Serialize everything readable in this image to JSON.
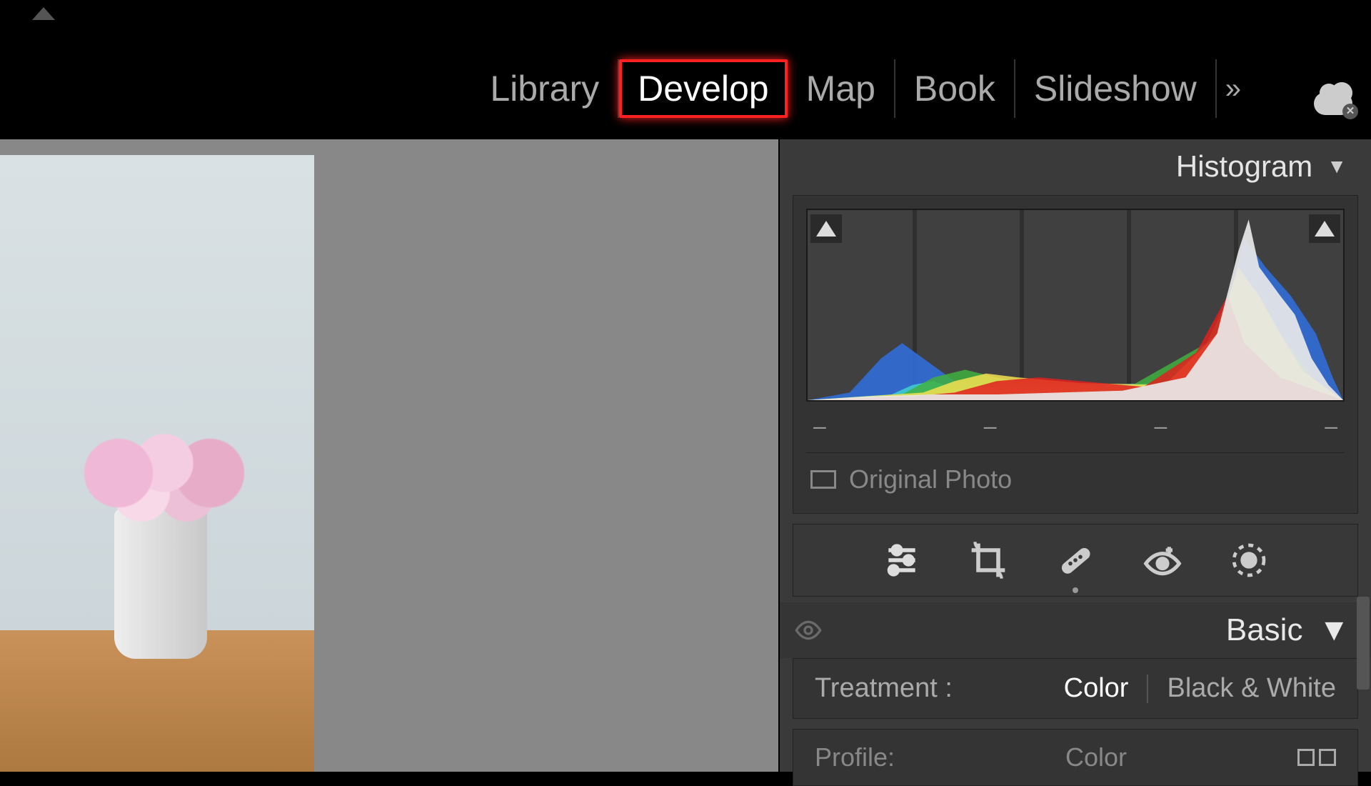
{
  "modules": {
    "items": [
      "Library",
      "Develop",
      "Map",
      "Book",
      "Slideshow"
    ],
    "active_index": 1
  },
  "panels": {
    "histogram": {
      "title": "Histogram"
    },
    "basic": {
      "title": "Basic"
    }
  },
  "histogram": {
    "info_placeholders": [
      "–",
      "–",
      "–",
      "–"
    ],
    "original_label": "Original Photo",
    "clip_shadow": "off",
    "clip_highlight": "off"
  },
  "tools": {
    "edit": "Edit",
    "crop": "Crop",
    "healing": "Healing",
    "redeye": "Red Eye",
    "masking": "Masking"
  },
  "basic": {
    "treatment_label": "Treatment :",
    "treatment_options": [
      "Color",
      "Black & White"
    ],
    "selected_treatment": "Color",
    "profile_label": "Profile:",
    "profile_value": "Color"
  },
  "chart_data": {
    "type": "area",
    "title": "Histogram",
    "xlabel": "",
    "ylabel": "",
    "xlim": [
      0,
      255
    ],
    "ylim": [
      0,
      100
    ],
    "series": [
      {
        "name": "luminance",
        "color": "#e8e8e8",
        "values": [
          [
            0,
            0
          ],
          [
            30,
            2
          ],
          [
            60,
            3
          ],
          [
            90,
            3
          ],
          [
            120,
            4
          ],
          [
            150,
            5
          ],
          [
            180,
            12
          ],
          [
            195,
            35
          ],
          [
            205,
            78
          ],
          [
            210,
            95
          ],
          [
            215,
            70
          ],
          [
            225,
            55
          ],
          [
            232,
            45
          ],
          [
            240,
            22
          ],
          [
            248,
            8
          ],
          [
            255,
            0
          ]
        ]
      },
      {
        "name": "red",
        "color": "#e02020",
        "values": [
          [
            0,
            0
          ],
          [
            50,
            2
          ],
          [
            70,
            4
          ],
          [
            90,
            10
          ],
          [
            110,
            12
          ],
          [
            130,
            10
          ],
          [
            160,
            7
          ],
          [
            185,
            25
          ],
          [
            200,
            55
          ],
          [
            208,
            30
          ],
          [
            225,
            12
          ],
          [
            255,
            0
          ]
        ]
      },
      {
        "name": "green",
        "color": "#40b040",
        "values": [
          [
            0,
            0
          ],
          [
            45,
            3
          ],
          [
            60,
            12
          ],
          [
            75,
            16
          ],
          [
            90,
            12
          ],
          [
            110,
            8
          ],
          [
            150,
            5
          ],
          [
            190,
            30
          ],
          [
            205,
            65
          ],
          [
            215,
            55
          ],
          [
            225,
            35
          ],
          [
            240,
            12
          ],
          [
            255,
            0
          ]
        ]
      },
      {
        "name": "blue",
        "color": "#3070e0",
        "values": [
          [
            0,
            0
          ],
          [
            20,
            4
          ],
          [
            35,
            22
          ],
          [
            45,
            30
          ],
          [
            55,
            22
          ],
          [
            70,
            10
          ],
          [
            110,
            4
          ],
          [
            170,
            6
          ],
          [
            195,
            30
          ],
          [
            208,
            85
          ],
          [
            218,
            70
          ],
          [
            230,
            55
          ],
          [
            242,
            35
          ],
          [
            250,
            12
          ],
          [
            255,
            0
          ]
        ]
      },
      {
        "name": "yellow",
        "color": "#f5e050",
        "values": [
          [
            0,
            0
          ],
          [
            55,
            4
          ],
          [
            70,
            10
          ],
          [
            85,
            14
          ],
          [
            100,
            12
          ],
          [
            130,
            9
          ],
          [
            170,
            8
          ],
          [
            195,
            35
          ],
          [
            205,
            70
          ],
          [
            215,
            55
          ],
          [
            225,
            35
          ],
          [
            236,
            15
          ],
          [
            255,
            0
          ]
        ]
      },
      {
        "name": "cyan",
        "color": "#40d0d0",
        "values": [
          [
            0,
            0
          ],
          [
            40,
            3
          ],
          [
            50,
            8
          ],
          [
            60,
            10
          ],
          [
            70,
            6
          ],
          [
            200,
            10
          ],
          [
            215,
            18
          ],
          [
            230,
            8
          ],
          [
            255,
            0
          ]
        ]
      }
    ]
  }
}
